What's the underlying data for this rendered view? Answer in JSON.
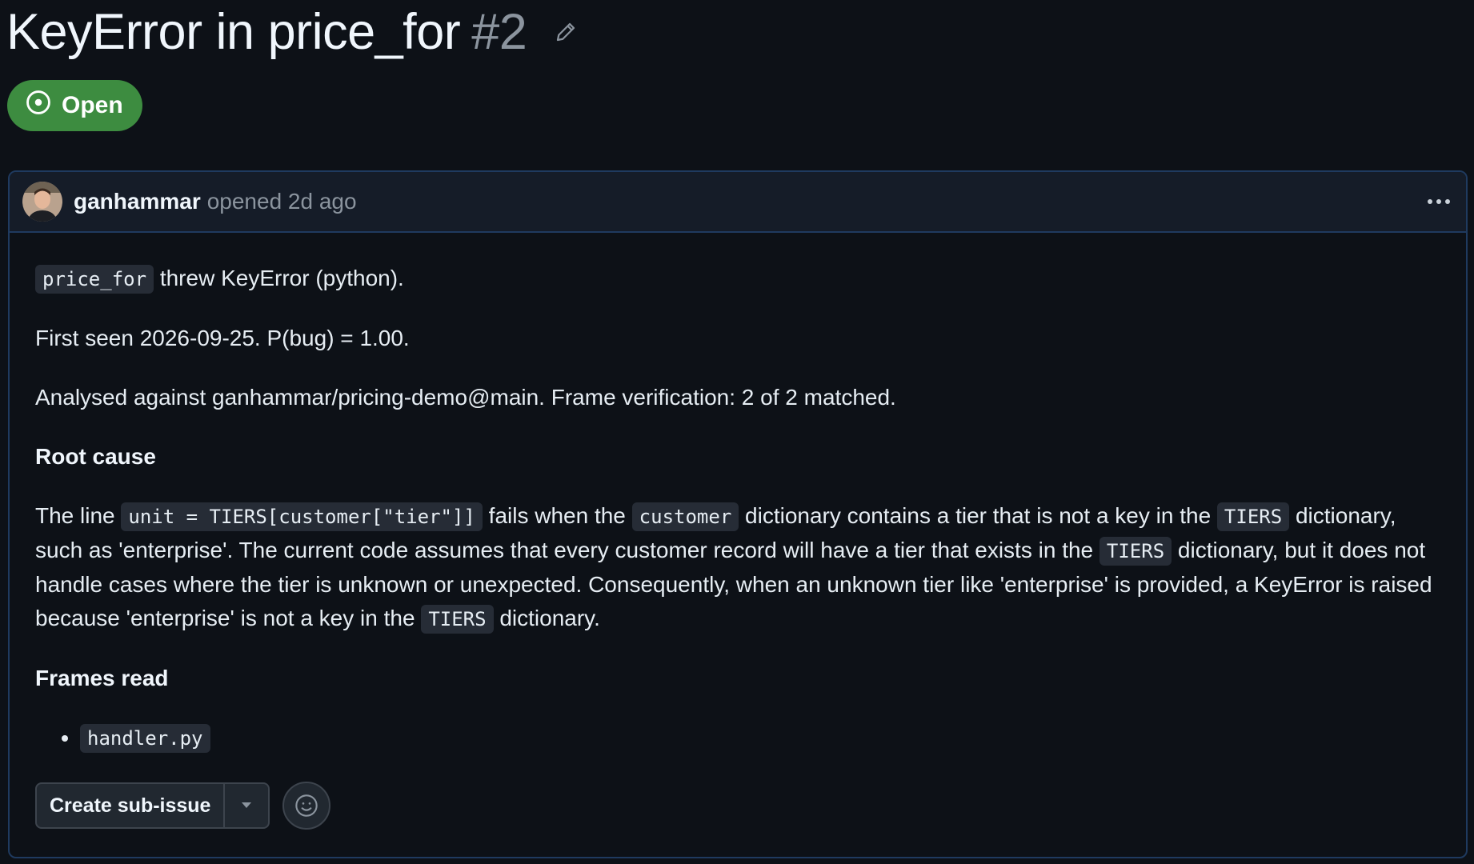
{
  "issue": {
    "title": "KeyError in price_for",
    "number": "#2",
    "state": "Open",
    "state_color": "#3d8c40"
  },
  "comment": {
    "author": "ganhammar",
    "meta": "opened 2d ago",
    "line1_code": "price_for",
    "line1_text": " threw KeyError (python).",
    "line2": "First seen 2026-09-25. P(bug) = 1.00.",
    "line3": "Analysed against ganhammar/pricing-demo@main. Frame verification: 2 of 2 matched.",
    "heading_root": "Root cause",
    "root_cause": {
      "t1": "The line ",
      "c1": "unit = TIERS[customer[\"tier\"]]",
      "t2": " fails when the ",
      "c2": "customer",
      "t3": " dictionary contains a tier that is not a key in the ",
      "c3": "TIERS",
      "t4": " dictionary, such as 'enterprise'. The current code assumes that every customer record will have a tier that exists in the ",
      "c4": "TIERS",
      "t5": " dictionary, but it does not handle cases where the tier is unknown or unexpected. Consequently, when an unknown tier like 'enterprise' is provided, a KeyError is raised because 'enterprise' is not a key in the ",
      "c5": "TIERS",
      "t6": " dictionary."
    },
    "heading_frames": "Frames read",
    "frames": [
      "handler.py"
    ]
  },
  "actions": {
    "create_sub_issue": "Create sub-issue"
  },
  "icons": {
    "edit": "pencil-icon",
    "state": "issue-open-icon",
    "more": "kebab-horizontal-icon",
    "dropdown": "triangle-down-icon",
    "reaction": "smiley-icon"
  },
  "colors": {
    "background": "#0d1117",
    "header_bg": "#151c28",
    "border": "#1f3a5f",
    "muted_text": "#8b949e"
  }
}
